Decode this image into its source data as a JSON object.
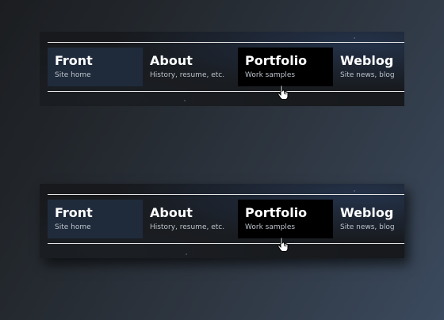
{
  "navigation_bars": [
    {
      "items": [
        {
          "title": "Front",
          "subtitle": "Site home",
          "state": "active"
        },
        {
          "title": "About",
          "subtitle": "History, resume, etc.",
          "state": "normal"
        },
        {
          "title": "Portfolio",
          "subtitle": "Work samples",
          "state": "hover"
        },
        {
          "title": "Weblog",
          "subtitle": "Site news, blog",
          "state": "normal"
        }
      ]
    },
    {
      "items": [
        {
          "title": "Front",
          "subtitle": "Site home",
          "state": "active"
        },
        {
          "title": "About",
          "subtitle": "History, resume, etc.",
          "state": "normal"
        },
        {
          "title": "Portfolio",
          "subtitle": "Work samples",
          "state": "hover"
        },
        {
          "title": "Weblog",
          "subtitle": "Site news, blog",
          "state": "normal"
        }
      ]
    }
  ],
  "cursor_icon": "hand-pointer-icon",
  "colors": {
    "active_background": "#1f2b3b",
    "hover_background": "#000000",
    "bar_background": "#17191c",
    "rule": "#e6e6e6"
  }
}
